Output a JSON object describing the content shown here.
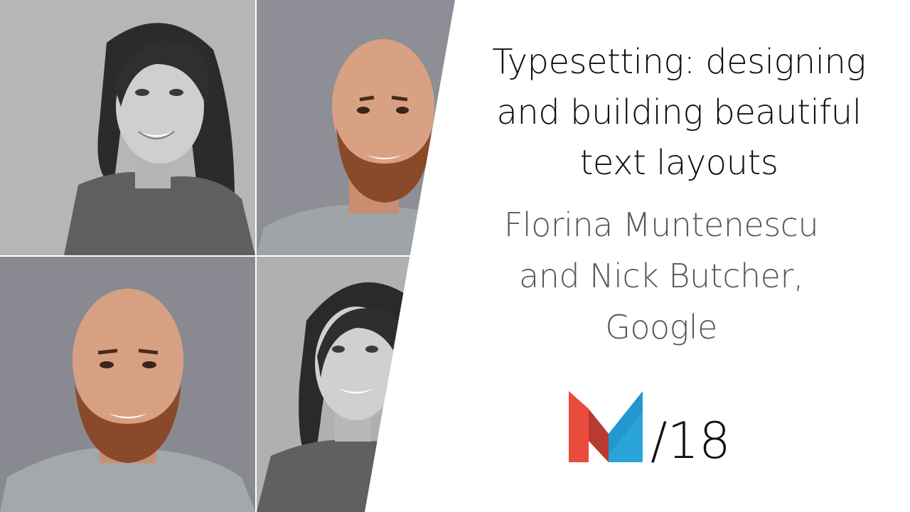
{
  "slide": {
    "title_lines": [
      "Typesetting: designing",
      "and building beautiful",
      "text layouts"
    ],
    "speaker_lines": [
      "Florina Muntenescu",
      "and Nick Butcher,",
      "Google"
    ],
    "edition": "/18"
  },
  "photos": [
    {
      "subject": "woman-portrait",
      "tone": "grayscale"
    },
    {
      "subject": "man-portrait",
      "tone": "color"
    },
    {
      "subject": "man-portrait",
      "tone": "color"
    },
    {
      "subject": "woman-portrait",
      "tone": "grayscale"
    }
  ],
  "logo": {
    "icon": "m-logo-icon",
    "colors": {
      "red": "#e94b3c",
      "blue": "#2aa5dc",
      "dark_red": "#b83a30"
    }
  },
  "colors": {
    "title_text": "#111111",
    "speaker_text": "#595959",
    "background": "#ffffff"
  }
}
